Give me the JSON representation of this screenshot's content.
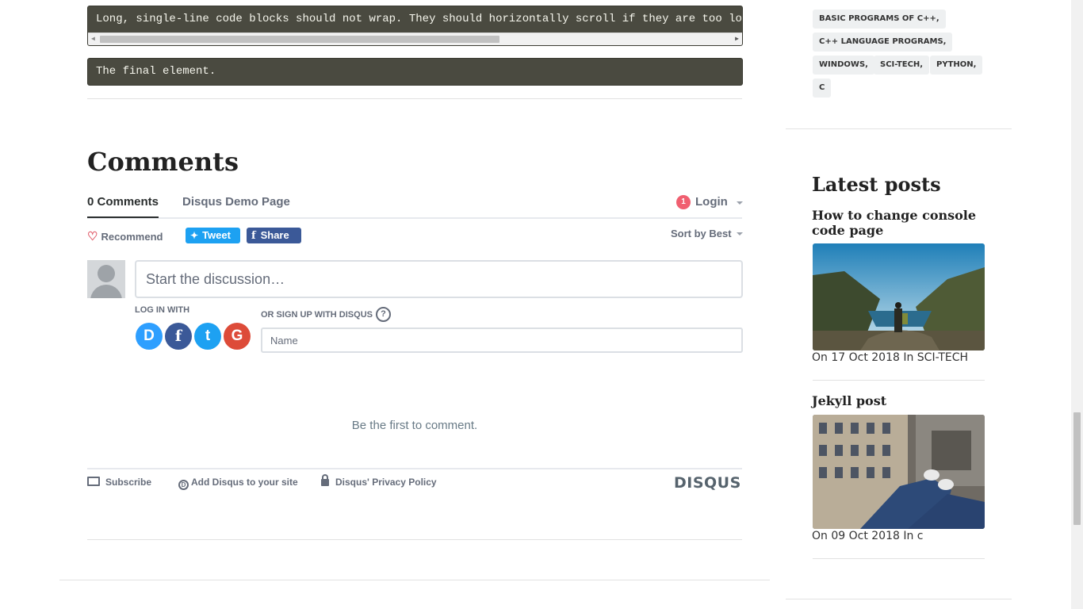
{
  "code": {
    "long_line": "Long, single-line code blocks should not wrap. They should horizontally scroll if they are too long.",
    "final": "The final element."
  },
  "comments": {
    "heading": "Comments",
    "tab_count": "0 Comments",
    "tab_site": "Disqus Demo Page",
    "notification_count": "1",
    "login": "Login",
    "recommend": "Recommend",
    "tweet": "Tweet",
    "share": "Share",
    "sort": "Sort by Best",
    "discussion_placeholder": "Start the discussion…",
    "log_in_with": "LOG IN WITH",
    "sign_up_with": "OR SIGN UP WITH DISQUS",
    "help": "?",
    "name_placeholder": "Name",
    "empty": "Be the first to comment.",
    "footer": {
      "subscribe": "Subscribe",
      "add_disqus": "Add Disqus to your site",
      "privacy": "Disqus' Privacy Policy",
      "logo": "DISQUS"
    },
    "social": {
      "disqus": "D",
      "facebook": "f",
      "twitter": "t",
      "google": "G"
    },
    "colors": {
      "tweet": "#1da1f2",
      "facebook": "#3b5998",
      "badge": "#f05f70"
    }
  },
  "sidebar": {
    "tags": [
      "BASIC PROGRAMS OF C++,",
      "C++ LANGUAGE PROGRAMS,",
      "WINDOWS,",
      "SCI-TECH,",
      "PYTHON,",
      "C"
    ],
    "latest_heading": "Latest posts",
    "posts": [
      {
        "title": "How to change console code page",
        "meta": "On 17 Oct 2018 In SCI-TECH"
      },
      {
        "title": "Jekyll post",
        "meta": "On 09 Oct 2018 In c"
      }
    ]
  }
}
